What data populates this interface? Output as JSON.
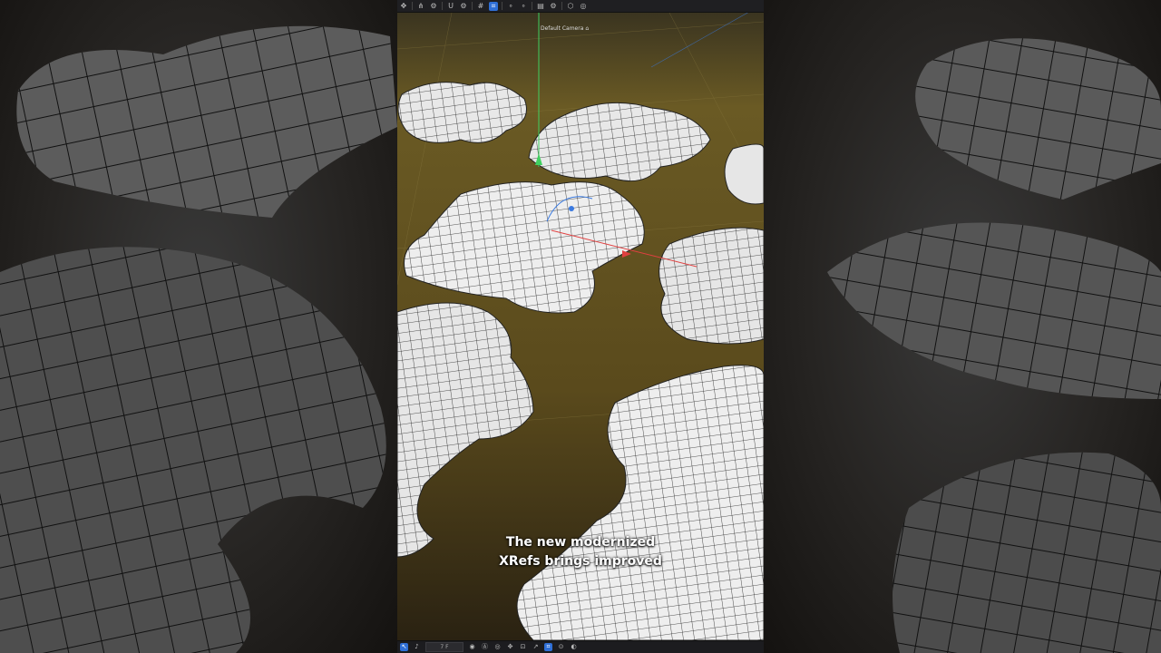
{
  "viewport": {
    "camera_label": "Default Camera",
    "camera_icon": "camera-icon",
    "frame_value": "7 F"
  },
  "caption": {
    "line1": "The new modernized",
    "line2": "XRefs brings improved"
  },
  "colors": {
    "active_tool": "#2f6fd6",
    "floor": "#6b5a22",
    "mesh": "#f0f0f0",
    "axis_x": "#e04040",
    "axis_y": "#40d060",
    "axis_z": "#3a7ae0"
  },
  "toolbar_icons": [
    "move-icon",
    "hierarchy-icon",
    "gear-icon",
    "magnet-icon",
    "gear-icon",
    "grid-icon",
    "snap-icon",
    "dots-icon",
    "render-icon",
    "gear-icon",
    "cube-icon",
    "target-icon"
  ],
  "bottom_icons": [
    "select-icon",
    "speaker-icon",
    "record-icon",
    "keyframe-icon",
    "target-icon",
    "move-icon",
    "bake-icon",
    "export-icon",
    "snap-icon",
    "link-icon",
    "camera-icon"
  ]
}
